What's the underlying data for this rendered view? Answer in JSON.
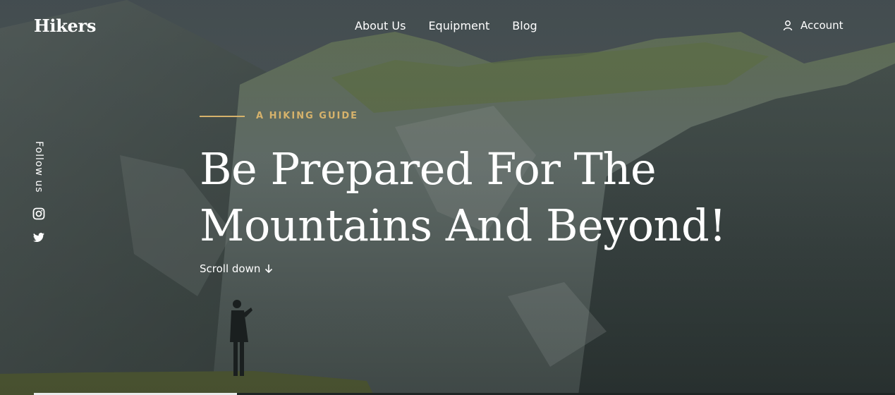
{
  "brand": {
    "name": "Hikers"
  },
  "nav": {
    "items": [
      {
        "label": "About Us"
      },
      {
        "label": "Equipment"
      },
      {
        "label": "Blog"
      }
    ],
    "account_label": "Account"
  },
  "social": {
    "label": "Follow us",
    "icons": [
      "instagram-icon",
      "twitter-icon"
    ]
  },
  "hero": {
    "eyebrow": "A HIKING GUIDE",
    "headline_line1": "Be Prepared For The",
    "headline_line2": "Mountains And Beyond!",
    "scroll_label": "Scroll down",
    "scroll_icon": "arrow-down-icon"
  },
  "colors": {
    "accent": "#d6b26b",
    "text": "#ffffff"
  }
}
